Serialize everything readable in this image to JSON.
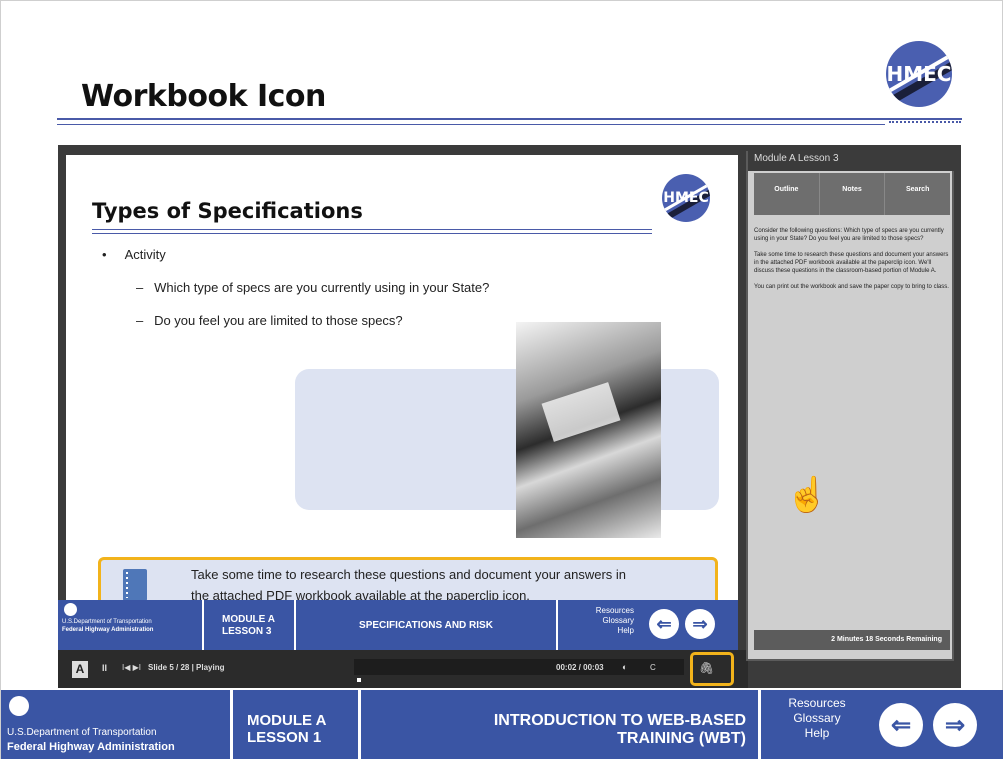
{
  "outer_slide": {
    "title": "Workbook Icon",
    "logo_text": "HMEC"
  },
  "inner_slide": {
    "title": "Types of Specifications",
    "logo_text": "HMEC",
    "bullet": "Activity",
    "sub_bullets": [
      "Which type of specs are you currently using in your State?",
      "Do you feel you are limited to those specs?"
    ],
    "callout_line1": "Take some time to research these questions and document your answers in",
    "callout_line2": "the attached PDF workbook available at the paperclip icon."
  },
  "inner_nav": {
    "dept": "U.S.Department of Transportation",
    "agency": "Federal Highway Administration",
    "module_line1": "MODULE A",
    "module_line2": "LESSON 3",
    "course_title": "SPECIFICATIONS AND RISK",
    "resources": [
      "Resources",
      "Glossary",
      "Help"
    ],
    "back_icon": "back-arrow-icon",
    "next_icon": "next-arrow-icon"
  },
  "controls": {
    "logo": "A",
    "pause": "II",
    "skip": "I◀ ▶I",
    "slide_status": "Slide 5 / 28 | Playing",
    "time": "00:02 / 00:03",
    "volume_icon": "volume-icon",
    "cc": "C",
    "paperclip_icon": "paperclip-icon"
  },
  "sidebar": {
    "title": "Module A Lesson 3",
    "tabs": [
      "Outline",
      "Notes",
      "Search"
    ],
    "notes": [
      "Consider the following questions: Which type of specs are you currently using in your State? Do you feel you are limited to those specs?",
      "Take some time to research these questions and document your answers in the attached PDF workbook available at the paperclip icon. We'll discuss these questions in the classroom-based portion of Module A.",
      "You can print out the workbook and save the paper copy to bring to class."
    ],
    "remaining": "2 Minutes 18 Seconds Remaining"
  },
  "outer_nav": {
    "dept": "U.S.Department of Transportation",
    "agency": "Federal Highway Administration",
    "module_line1": "MODULE A",
    "module_line2": "LESSON 1",
    "course_line1": "INTRODUCTION TO WEB-BASED",
    "course_line2": "TRAINING (WBT)",
    "resources": [
      "Resources",
      "Glossary",
      "Help"
    ],
    "back_icon": "back-arrow-icon",
    "next_icon": "next-arrow-icon"
  }
}
